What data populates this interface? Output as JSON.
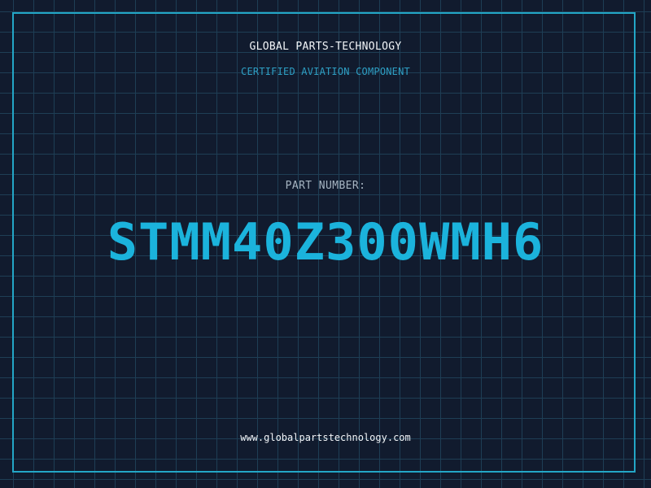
{
  "header": {
    "company": "GLOBAL PARTS-TECHNOLOGY",
    "subtitle": "CERTIFIED AVIATION COMPONENT"
  },
  "part": {
    "label": "PART NUMBER:",
    "number": "STMM40Z300WMH6"
  },
  "footer": {
    "website": "www.globalpartstechnology.com"
  },
  "colors": {
    "background": "#111b2e",
    "grid": "#1e3e55",
    "frame": "#23a6c6",
    "accent": "#1bb3dc",
    "text": "#f2f5f8",
    "muted": "#a6b5c2"
  }
}
